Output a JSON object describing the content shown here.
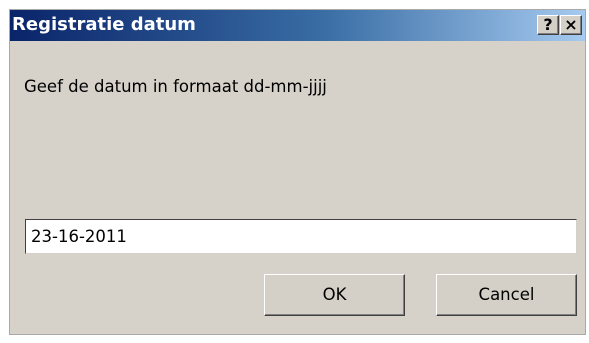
{
  "window": {
    "title": "Registratie datum",
    "help_label": "?",
    "close_label": "×"
  },
  "prompt": {
    "text": "Geef de datum in formaat dd-mm-jjjj"
  },
  "date_input": {
    "value": "23-16-2011",
    "placeholder": ""
  },
  "buttons": {
    "ok_label": "OK",
    "cancel_label": "Cancel"
  },
  "colors": {
    "title_gradient_start": "#0a246a",
    "title_gradient_end": "#a6caf0",
    "dialog_background": "#d6d2ca"
  },
  "icons": {
    "help": "help-icon",
    "close": "close-icon"
  }
}
